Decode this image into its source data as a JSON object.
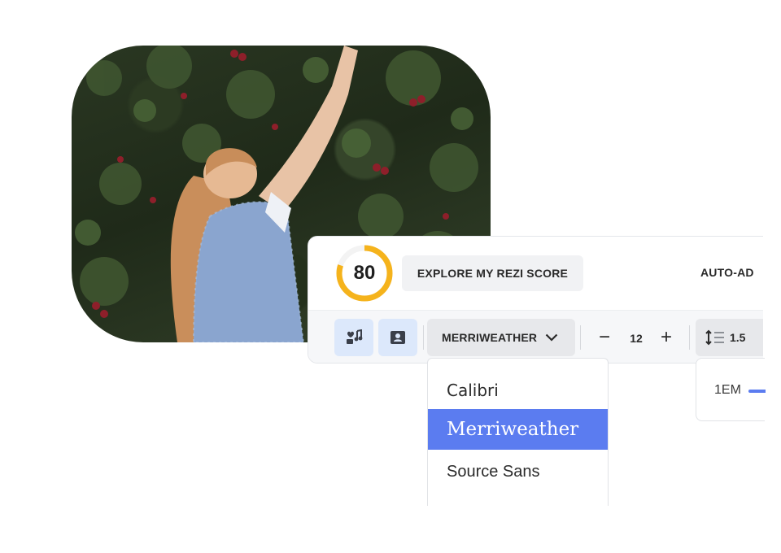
{
  "score": {
    "value": "80",
    "percent": 0.8,
    "ring_color": "#f5b31c"
  },
  "header": {
    "explore_label": "EXPLORE MY REZI SCORE",
    "auto_adjust_label": "AUTO-AD"
  },
  "toolbar": {
    "theme_icon": "music-heart-icon",
    "profile_icon": "profile-card-icon",
    "font_label": "MERRIWEATHER",
    "size_minus": "−",
    "size_value": "12",
    "size_plus": "+",
    "line_spacing_value": "1.5"
  },
  "font_dropdown": {
    "options": [
      "Calibri",
      "Merriweather",
      "Source Sans"
    ],
    "selected": "Merriweather",
    "highlight_color": "#5b7cf0"
  },
  "spacing_popover": {
    "label": "1EM"
  }
}
